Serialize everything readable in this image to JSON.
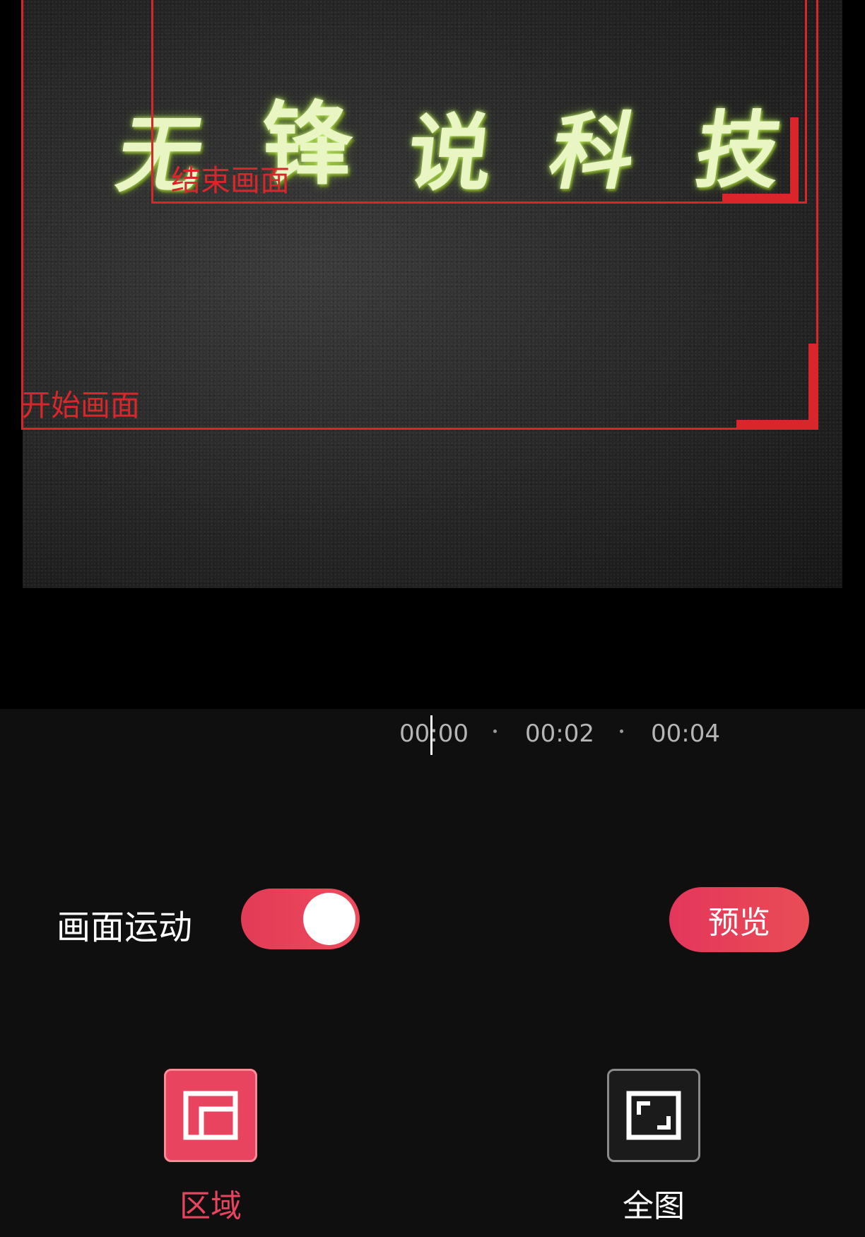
{
  "preview": {
    "title_chars": [
      "无",
      "锋",
      "说",
      "科",
      "技"
    ],
    "end_frame_label": "结束画面",
    "start_frame_label": "开始画面",
    "frame_color": "#d8262b"
  },
  "timeline": {
    "times": [
      "00:00",
      "00:02",
      "00:04"
    ],
    "current_time": "00:00"
  },
  "motion": {
    "label": "画面运动",
    "toggle_on": true,
    "preview_button": "预览"
  },
  "modes": [
    {
      "label": "区域",
      "icon": "region-icon",
      "selected": true
    },
    {
      "label": "全图",
      "icon": "fullscreen-icon",
      "selected": false
    }
  ],
  "colors": {
    "accent": "#e9445f",
    "panel_background": "#0f0f0f",
    "title_glow": "#e9f6c4"
  }
}
